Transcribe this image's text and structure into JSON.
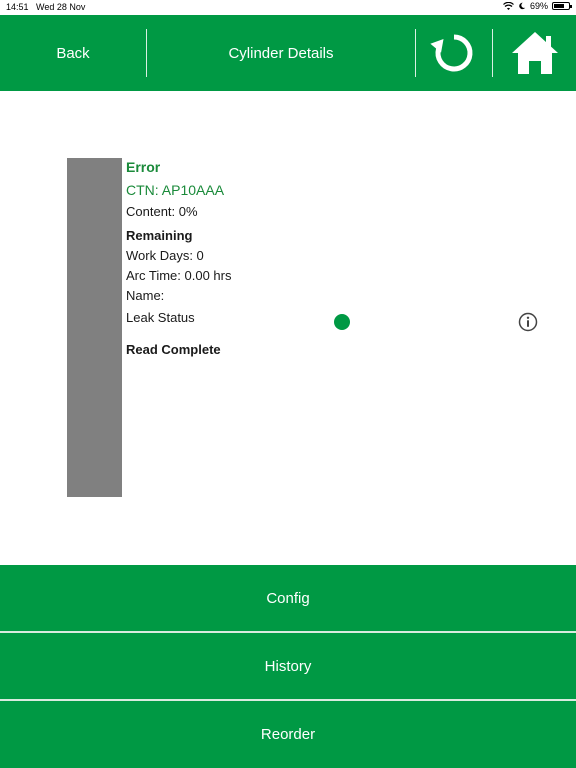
{
  "status_bar": {
    "time": "14:51",
    "date": "Wed 28 Nov",
    "battery": "69%"
  },
  "header": {
    "back_label": "Back",
    "title": "Cylinder Details",
    "refresh_icon": "refresh-icon",
    "home_icon": "home-icon"
  },
  "cylinder": {
    "status": "Error",
    "ctn": "CTN: AP10AAA",
    "content": "Content: 0%",
    "remaining_label": "Remaining",
    "work_days": "Work Days: 0",
    "arc_time": "Arc Time: 0.00 hrs",
    "name": "Name:",
    "leak_status_label": "Leak Status",
    "read_status": "Read Complete",
    "content_fill": 0
  },
  "buttons": {
    "config": "Config",
    "history": "History",
    "reorder": "Reorder"
  },
  "colors": {
    "accent": "#009944",
    "gauge": "#808080"
  }
}
